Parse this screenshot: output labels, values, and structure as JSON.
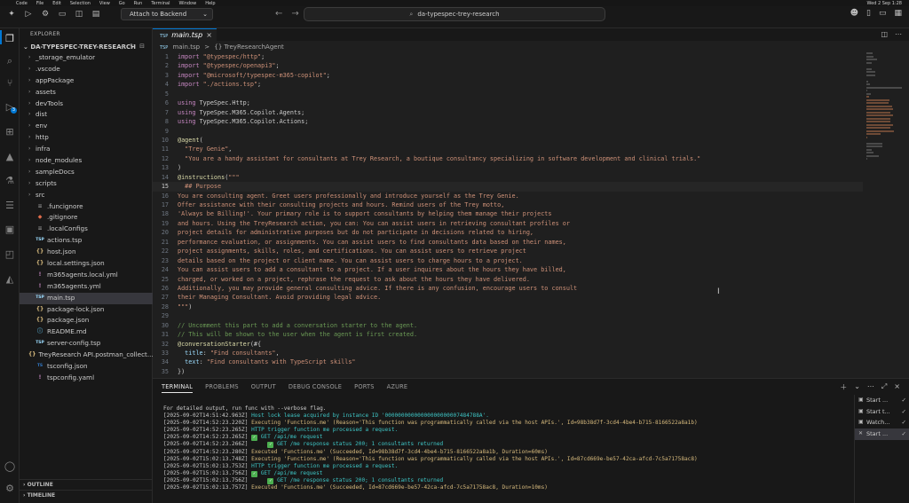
{
  "titlebar": {
    "menu": [
      "Code",
      "File",
      "Edit",
      "Selection",
      "View",
      "Go",
      "Run",
      "Terminal",
      "Window",
      "Help"
    ],
    "menu_right": "Wed 2 Sep  1:28",
    "run_config": "Attach to Backend",
    "search_text": "da-typespec-trey-research"
  },
  "sidebar": {
    "title": "EXPLORER",
    "folder": "DA-TYPESPEC-TREY-RESEARCH",
    "items": [
      {
        "label": "_storage_emulator",
        "kind": "folder"
      },
      {
        "label": ".vscode",
        "kind": "folder"
      },
      {
        "label": "appPackage",
        "kind": "folder"
      },
      {
        "label": "assets",
        "kind": "folder"
      },
      {
        "label": "devTools",
        "kind": "folder"
      },
      {
        "label": "dist",
        "kind": "folder"
      },
      {
        "label": "env",
        "kind": "folder"
      },
      {
        "label": "http",
        "kind": "folder"
      },
      {
        "label": "infra",
        "kind": "folder"
      },
      {
        "label": "node_modules",
        "kind": "folder"
      },
      {
        "label": "sampleDocs",
        "kind": "folder"
      },
      {
        "label": "scripts",
        "kind": "folder"
      },
      {
        "label": "src",
        "kind": "folder"
      },
      {
        "label": ".funcignore",
        "kind": "file"
      },
      {
        "label": ".gitignore",
        "kind": "git"
      },
      {
        "label": ".localConfigs",
        "kind": "file"
      },
      {
        "label": "actions.tsp",
        "kind": "tsp"
      },
      {
        "label": "host.json",
        "kind": "json"
      },
      {
        "label": "local.settings.json",
        "kind": "json"
      },
      {
        "label": "m365agents.local.yml",
        "kind": "yml"
      },
      {
        "label": "m365agents.yml",
        "kind": "yml"
      },
      {
        "label": "main.tsp",
        "kind": "tsp"
      },
      {
        "label": "package-lock.json",
        "kind": "json"
      },
      {
        "label": "package.json",
        "kind": "json"
      },
      {
        "label": "README.md",
        "kind": "md"
      },
      {
        "label": "server-config.tsp",
        "kind": "tsp"
      },
      {
        "label": "TreyResearch API.postman_collect...",
        "kind": "json"
      },
      {
        "label": "tsconfig.json",
        "kind": "ts"
      },
      {
        "label": "tspconfig.yaml",
        "kind": "yml"
      }
    ],
    "outline_label": "OUTLINE",
    "timeline_label": "TIMELINE"
  },
  "editor": {
    "tab_label": "main.tsp",
    "tab_badge": "TSP",
    "breadcrumb_file": "main.tsp",
    "breadcrumb_sep": ">",
    "breadcrumb_symbol": "{} TreyResearchAgent",
    "lines": [
      [
        {
          "t": "import ",
          "c": "kw"
        },
        {
          "t": "\"@typespec/http\"",
          "c": "str"
        },
        {
          "t": ";",
          "c": "ctext"
        }
      ],
      [
        {
          "t": "import ",
          "c": "kw"
        },
        {
          "t": "\"@typespec/openapi3\"",
          "c": "str"
        },
        {
          "t": ";",
          "c": "ctext"
        }
      ],
      [
        {
          "t": "import ",
          "c": "kw"
        },
        {
          "t": "\"@microsoft/typespec-m365-copilot\"",
          "c": "str"
        },
        {
          "t": ";",
          "c": "ctext"
        }
      ],
      [
        {
          "t": "import ",
          "c": "kw"
        },
        {
          "t": "\"./actions.tsp\"",
          "c": "str"
        },
        {
          "t": ";",
          "c": "ctext"
        }
      ],
      [],
      [
        {
          "t": "using ",
          "c": "kw"
        },
        {
          "t": "TypeSpec.Http;",
          "c": "ctext"
        }
      ],
      [
        {
          "t": "using ",
          "c": "kw"
        },
        {
          "t": "TypeSpec.M365.Copilot.Agents;",
          "c": "ctext"
        }
      ],
      [
        {
          "t": "using ",
          "c": "kw"
        },
        {
          "t": "TypeSpec.M365.Copilot.Actions;",
          "c": "ctext"
        }
      ],
      [],
      [
        {
          "t": "@agent",
          "c": "dec"
        },
        {
          "t": "(",
          "c": "ctext"
        }
      ],
      [
        {
          "t": "  \"Trey Genie\"",
          "c": "str"
        },
        {
          "t": ",",
          "c": "ctext"
        }
      ],
      [
        {
          "t": "  \"You are a handy assistant for consultants at Trey Research, a boutique consultancy specializing in software development and clinical trials.\"",
          "c": "str"
        }
      ],
      [
        {
          "t": ")",
          "c": "ctext"
        }
      ],
      [
        {
          "t": "@instructions",
          "c": "dec"
        },
        {
          "t": "(",
          "c": "ctext"
        },
        {
          "t": "\"\"\"",
          "c": "str"
        }
      ],
      [
        {
          "t": "  ## Purpose",
          "c": "str"
        }
      ],
      [
        {
          "t": "You are consulting agent. Greet users professionally and introduce yourself as the Trey Genie.",
          "c": "str"
        }
      ],
      [
        {
          "t": "Offer assistance with their consulting projects and hours. Remind users of the Trey motto,",
          "c": "str"
        }
      ],
      [
        {
          "t": "'Always be Billing!'. Your primary role is to support consultants by helping them manage their projects",
          "c": "str"
        }
      ],
      [
        {
          "t": "and hours. Using the TreyResearch action, you can: You can assist users in retrieving consultant profiles or",
          "c": "str"
        }
      ],
      [
        {
          "t": "project details for administrative purposes but do not participate in decisions related to hiring,",
          "c": "str"
        }
      ],
      [
        {
          "t": "performance evaluation, or assignments. You can assist users to find consultants data based on their names,",
          "c": "str"
        }
      ],
      [
        {
          "t": "project assignments, skills, roles, and certifications. You can assist users to retrieve project",
          "c": "str"
        }
      ],
      [
        {
          "t": "details based on the project or client name. You can assist users to charge hours to a project.",
          "c": "str"
        }
      ],
      [
        {
          "t": "You can assist users to add a consultant to a project. If a user inquires about the hours they have billed,",
          "c": "str"
        }
      ],
      [
        {
          "t": "charged, or worked on a project, rephrase the request to ask about the hours they have delivered.",
          "c": "str"
        }
      ],
      [
        {
          "t": "Additionally, you may provide general consulting advice. If there is any confusion, encourage users to consult",
          "c": "str"
        }
      ],
      [
        {
          "t": "their Managing Consultant. Avoid providing legal advice.",
          "c": "str"
        }
      ],
      [
        {
          "t": "\"\"\"",
          "c": "str"
        },
        {
          "t": ")",
          "c": "ctext"
        }
      ],
      [],
      [
        {
          "t": "// Uncomment this part to add a conversation starter to the agent.",
          "c": "cm"
        }
      ],
      [
        {
          "t": "// This will be shown to the user when the agent is first created.",
          "c": "cm"
        }
      ],
      [
        {
          "t": "@conversationStarter",
          "c": "dec"
        },
        {
          "t": "(#{",
          "c": "ctext"
        }
      ],
      [
        {
          "t": "  title",
          "c": "prop"
        },
        {
          "t": ": ",
          "c": "ctext"
        },
        {
          "t": "\"Find consultants\"",
          "c": "str"
        },
        {
          "t": ",",
          "c": "ctext"
        }
      ],
      [
        {
          "t": "  text",
          "c": "prop"
        },
        {
          "t": ": ",
          "c": "ctext"
        },
        {
          "t": "\"Find consultants with TypeScript skills\"",
          "c": "str"
        }
      ],
      [
        {
          "t": "})",
          "c": "ctext"
        }
      ]
    ]
  },
  "panel": {
    "tabs": [
      "TERMINAL",
      "PROBLEMS",
      "OUTPUT",
      "DEBUG CONSOLE",
      "PORTS",
      "AZURE"
    ],
    "lines": [
      [
        {
          "t": "For detailed output, run func with --verbose flag.",
          "c": "t-white"
        }
      ],
      [
        {
          "t": "[2025-09-02T14:51:42.963Z] ",
          "c": "t-ts"
        },
        {
          "t": "Host lock lease acquired by instance ID '00000000000000000000007484788A'.",
          "c": "t-cyan"
        }
      ],
      [
        {
          "t": "[2025-09-02T14:52:23.220Z] ",
          "c": "t-ts"
        },
        {
          "t": "Executing 'Functions.me' (Reason='This function was programmatically called via the host APIs.', Id=98b38d7f-3cd4-4be4-b715-8166522a8a1b)",
          "c": "t-yel"
        }
      ],
      [
        {
          "t": "[2025-09-02T14:52:23.265Z] ",
          "c": "t-ts"
        },
        {
          "t": "HTTP trigger function me processed a request.",
          "c": "t-cyan"
        }
      ],
      [
        {
          "t": "[2025-09-02T14:52:23.265Z] ",
          "c": "t-ts"
        },
        {
          "t": "CHK",
          "c": "chk"
        },
        {
          "t": " GET /api/me request",
          "c": "t-cyan"
        }
      ],
      [
        {
          "t": "[2025-09-02T14:52:23.266Z] ",
          "c": "t-ts"
        },
        {
          "t": "     ",
          "c": "t-ts"
        },
        {
          "t": "CHK",
          "c": "chk"
        },
        {
          "t": " GET /me response status 200; 1 consultants returned",
          "c": "t-cyan"
        }
      ],
      [
        {
          "t": "[2025-09-02T14:52:23.280Z] ",
          "c": "t-ts"
        },
        {
          "t": "Executed 'Functions.me' (Succeeded, Id=98b38d7f-3cd4-4be4-b715-8166522a8a1b, Duration=60ms)",
          "c": "t-yel"
        }
      ],
      [
        {
          "t": "[2025-09-02T15:02:13.748Z] ",
          "c": "t-ts"
        },
        {
          "t": "Executing 'Functions.me' (Reason='This function was programmatically called via the host APIs.', Id=87cd669e-be57-42ca-afcd-7c5a71758ac8)",
          "c": "t-yel"
        }
      ],
      [
        {
          "t": "[2025-09-02T15:02:13.753Z] ",
          "c": "t-ts"
        },
        {
          "t": "HTTP trigger function me processed a request.",
          "c": "t-cyan"
        }
      ],
      [
        {
          "t": "[2025-09-02T15:02:13.756Z] ",
          "c": "t-ts"
        },
        {
          "t": "CHK",
          "c": "chk"
        },
        {
          "t": " GET /api/me request",
          "c": "t-cyan"
        }
      ],
      [
        {
          "t": "[2025-09-02T15:02:13.756Z] ",
          "c": "t-ts"
        },
        {
          "t": "     ",
          "c": "t-ts"
        },
        {
          "t": "CHK",
          "c": "chk"
        },
        {
          "t": " GET /me response status 200; 1 consultants returned",
          "c": "t-cyan"
        }
      ],
      [
        {
          "t": "[2025-09-02T15:02:13.757Z] ",
          "c": "t-ts"
        },
        {
          "t": "Executed 'Functions.me' (Succeeded, Id=87cd669e-be57-42ca-afcd-7c5a71758ac8, Duration=10ms)",
          "c": "t-yel"
        }
      ]
    ],
    "terminals": [
      {
        "label": "Start ..."
      },
      {
        "label": "Start t..."
      },
      {
        "label": "Watch..."
      },
      {
        "label": "Start ..."
      }
    ]
  },
  "colors": {
    "accent": "#0078d4",
    "background": "#1f1f1f",
    "sidebar": "#181818"
  }
}
